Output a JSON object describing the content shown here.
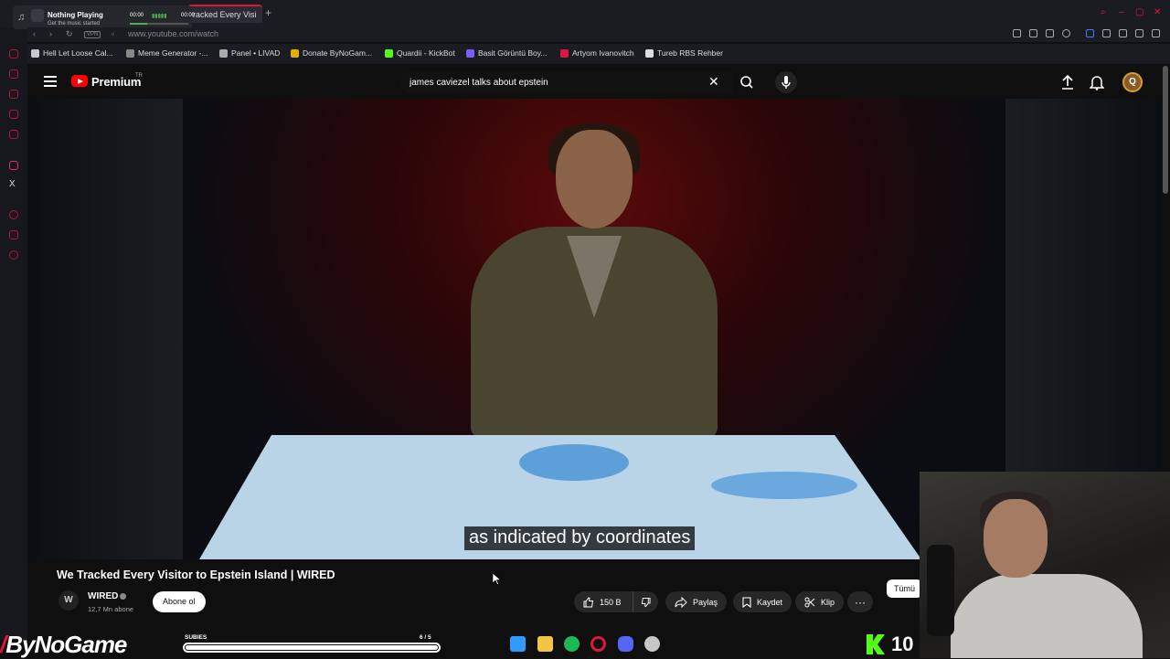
{
  "browser": {
    "active_tab_title": "racked Every Visi",
    "url": "www.youtube.com/watch",
    "new_tab": "+",
    "vpn_badge": "VPN",
    "bookmarks": [
      {
        "label": "Hell Let Loose Cal...",
        "color": "#c9c9c9"
      },
      {
        "label": "Meme Generator -...",
        "color": "#888888"
      },
      {
        "label": "Panel • LIVAD",
        "color": "#aaaaaa"
      },
      {
        "label": "Donate ByNoGam...",
        "color": "#e0b000"
      },
      {
        "label": "Quardii - KickBot",
        "color": "#53fc18"
      },
      {
        "label": "Basit Görüntü Boy...",
        "color": "#7a5cff"
      },
      {
        "label": "Artyom Ivanovitch",
        "color": "#e0163c"
      },
      {
        "label": "Tureb RBS Rehber",
        "color": "#dddddd"
      }
    ]
  },
  "music_player": {
    "title": "Nothing Playing",
    "subtitle": "Get the music started",
    "time_start": "00:00",
    "time_end": "00:00",
    "progress": 0.3
  },
  "youtube": {
    "brand": "Premium",
    "country": "TR",
    "search_query": "james caviezel talks about epstein",
    "subtitle_text": "as indicated by coordinates",
    "video_title": "We Tracked Every Visitor to Epstein Island | WIRED",
    "channel": {
      "name": "WIRED",
      "avatar_letter": "W",
      "subscribers": "12,7 Mn abone"
    },
    "subscribe_label": "Abone ol",
    "like_count": "150 B",
    "share_label": "Paylaş",
    "save_label": "Kaydet",
    "clip_label": "Klip",
    "more_label": "···",
    "chip_all": "Tümü",
    "avatar_letter": "Q"
  },
  "stream_overlay": {
    "brand": "ByNoGame",
    "subgoal_label": "SUBIES",
    "subgoal_count": "6 / 5",
    "subgoal_progress": 1.0,
    "viewer_count": "10",
    "accent": "#e0163c",
    "kick_color": "#53fc18"
  },
  "taskbar": [
    {
      "name": "windows-start-icon",
      "color": "#2f9bff"
    },
    {
      "name": "file-explorer-icon",
      "color": "#f4c542"
    },
    {
      "name": "spotify-icon",
      "color": "#1db954"
    },
    {
      "name": "opera-gx-icon",
      "color": "#e0163c"
    },
    {
      "name": "discord-icon",
      "color": "#5865f2"
    },
    {
      "name": "steam-icon",
      "color": "#c7c7c7"
    }
  ]
}
